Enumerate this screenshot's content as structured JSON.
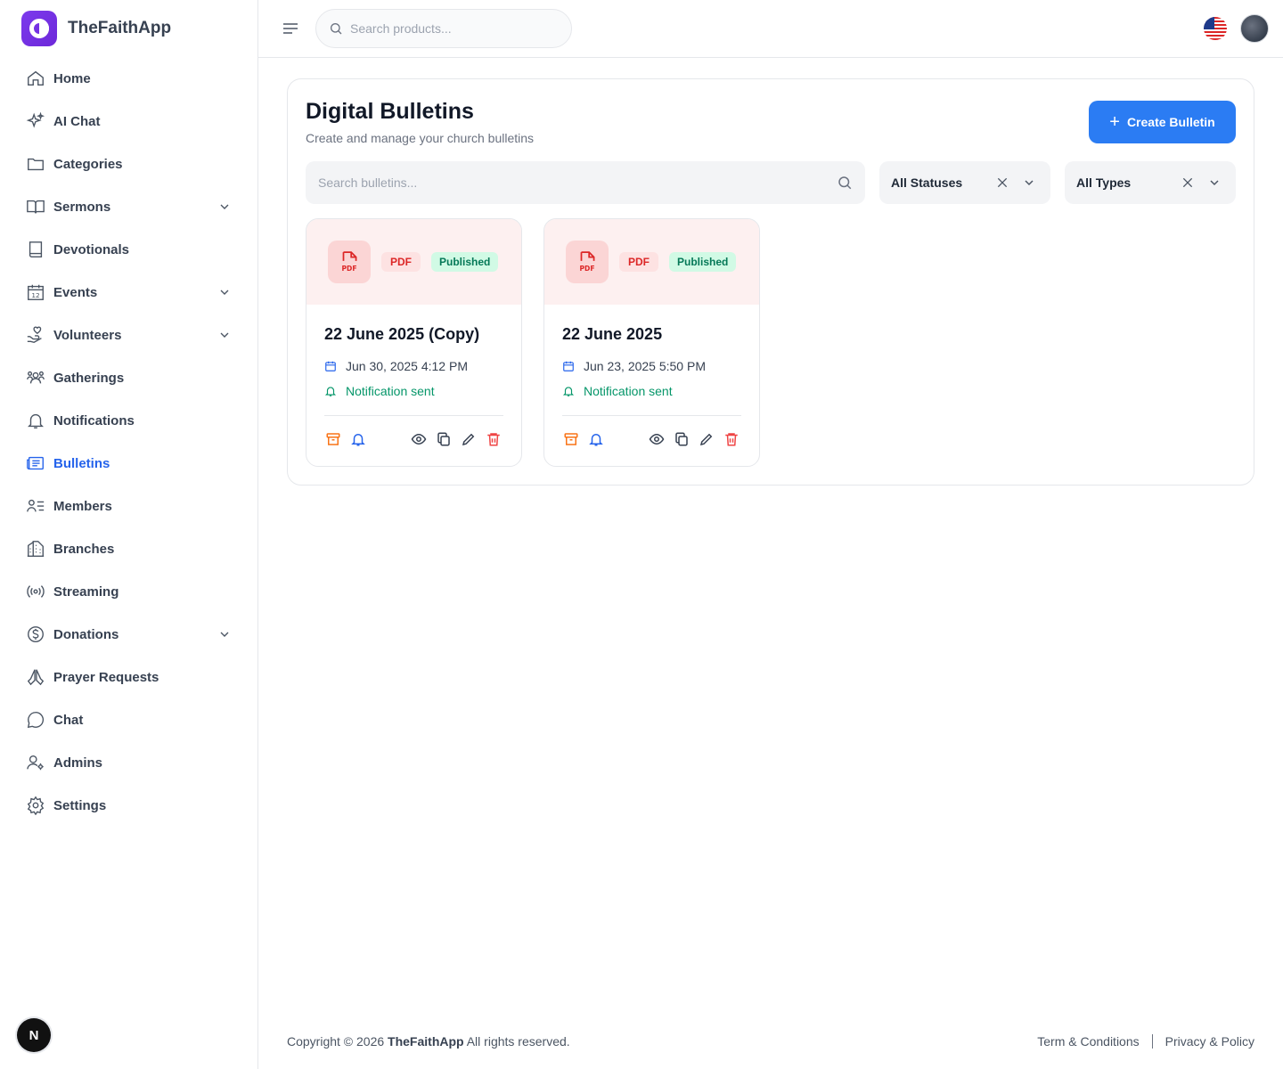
{
  "app": {
    "name": "TheFaithApp"
  },
  "sidebar": {
    "items": [
      {
        "label": "Home"
      },
      {
        "label": "AI Chat"
      },
      {
        "label": "Categories"
      },
      {
        "label": "Sermons"
      },
      {
        "label": "Devotionals"
      },
      {
        "label": "Events"
      },
      {
        "label": "Volunteers"
      },
      {
        "label": "Gatherings"
      },
      {
        "label": "Notifications"
      },
      {
        "label": "Bulletins"
      },
      {
        "label": "Members"
      },
      {
        "label": "Branches"
      },
      {
        "label": "Streaming"
      },
      {
        "label": "Donations"
      },
      {
        "label": "Prayer Requests"
      },
      {
        "label": "Chat"
      },
      {
        "label": "Admins"
      },
      {
        "label": "Settings"
      }
    ],
    "active": "Bulletins",
    "next_badge": "N"
  },
  "topbar": {
    "search_placeholder": "Search products..."
  },
  "main": {
    "title": "Digital Bulletins",
    "subtitle": "Create and manage your church bulletins",
    "create_label": "Create Bulletin",
    "search_placeholder": "Search bulletins...",
    "status_filter": "All Statuses",
    "type_filter": "All Types",
    "cards": [
      {
        "type": "PDF",
        "status": "Published",
        "title": "22 June 2025 (Copy)",
        "date": "Jun 30, 2025 4:12 PM",
        "notification": "Notification sent"
      },
      {
        "type": "PDF",
        "status": "Published",
        "title": "22 June 2025",
        "date": "Jun 23, 2025 5:50 PM",
        "notification": "Notification sent"
      }
    ]
  },
  "footer": {
    "copyright_prefix": "Copyright © 2026",
    "brand": "TheFaithApp",
    "copyright_suffix": "All rights reserved.",
    "terms": "Term & Conditions",
    "privacy": "Privacy & Policy"
  },
  "colors": {
    "accent": "#2b7cf3",
    "brand": "#7c3aed",
    "published_bg": "#d1fae5",
    "pdf_bg": "#fde2e2",
    "notification_green": "#059669"
  }
}
